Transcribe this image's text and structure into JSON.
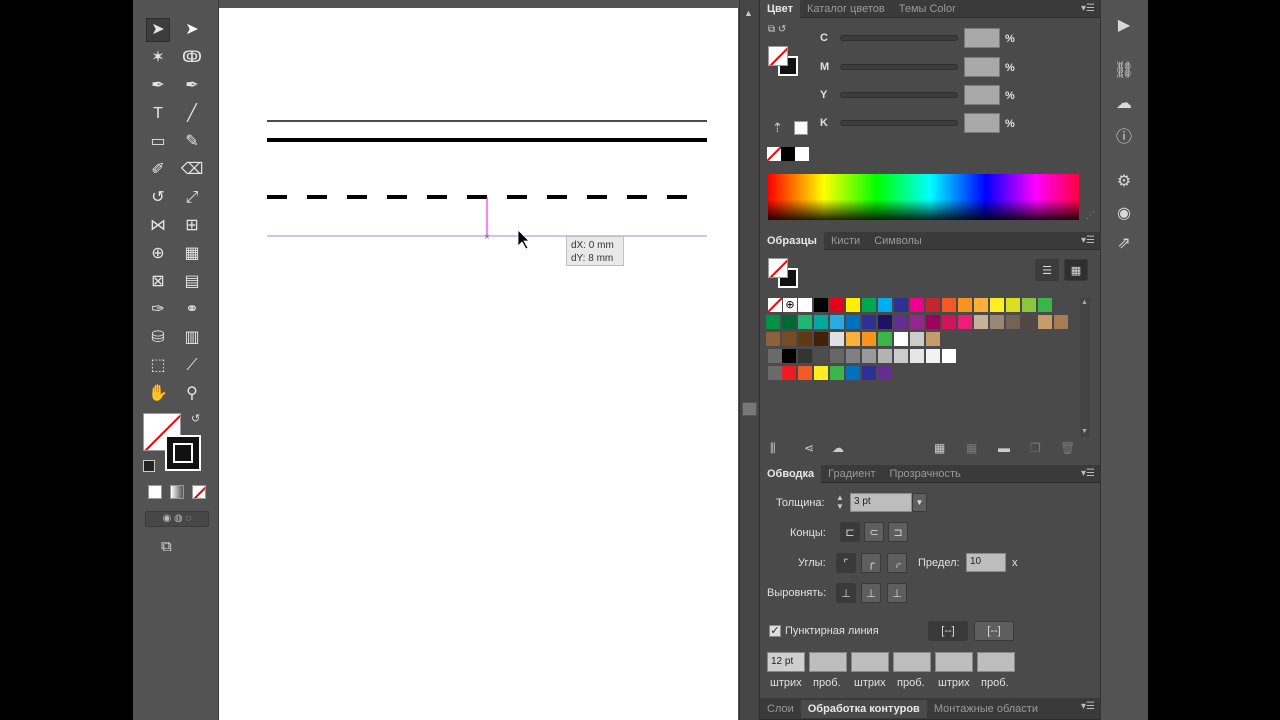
{
  "colors": {
    "panel_bg": "#4a4a4a",
    "toolbar_bg": "#535353",
    "artboard": "#ffffff",
    "guide_blue": "#8b8bff",
    "magenta": "#ff00ff"
  },
  "tools": [
    {
      "name": "selection-tool",
      "icon": "arrow-icon",
      "glyph": "➤"
    },
    {
      "name": "direct-selection-tool",
      "icon": "white-arrow-icon",
      "glyph": "➤"
    },
    {
      "name": "magic-wand-tool",
      "icon": "magic-wand-icon",
      "glyph": "✶"
    },
    {
      "name": "lasso-tool",
      "icon": "lasso-icon",
      "glyph": "ↂ"
    },
    {
      "name": "pen-tool",
      "icon": "pen-icon",
      "glyph": "✒"
    },
    {
      "name": "curvature-tool",
      "icon": "curvature-pen-icon",
      "glyph": "✒"
    },
    {
      "name": "type-tool",
      "icon": "type-icon",
      "glyph": "T"
    },
    {
      "name": "line-tool",
      "icon": "line-icon",
      "glyph": "╱"
    },
    {
      "name": "rectangle-tool",
      "icon": "rectangle-icon",
      "glyph": "▭"
    },
    {
      "name": "paintbrush-tool",
      "icon": "brush-icon",
      "glyph": "✎"
    },
    {
      "name": "shaper-tool",
      "icon": "shaper-icon",
      "glyph": "✐"
    },
    {
      "name": "eraser-tool",
      "icon": "eraser-icon",
      "glyph": "⌫"
    },
    {
      "name": "rotate-tool",
      "icon": "rotate-icon",
      "glyph": "↺"
    },
    {
      "name": "scale-tool",
      "icon": "scale-icon",
      "glyph": "⤢"
    },
    {
      "name": "width-tool",
      "icon": "width-icon",
      "glyph": "⋈"
    },
    {
      "name": "free-transform-tool",
      "icon": "free-transform-icon",
      "glyph": "⊞"
    },
    {
      "name": "shape-builder-tool",
      "icon": "shape-builder-icon",
      "glyph": "⊕"
    },
    {
      "name": "perspective-grid-tool",
      "icon": "perspective-grid-icon",
      "glyph": "▦"
    },
    {
      "name": "mesh-tool",
      "icon": "mesh-icon",
      "glyph": "⊠"
    },
    {
      "name": "gradient-tool",
      "icon": "gradient-icon",
      "glyph": "▤"
    },
    {
      "name": "eyedropper-tool",
      "icon": "eyedropper-icon",
      "glyph": "✑"
    },
    {
      "name": "blend-tool",
      "icon": "blend-icon",
      "glyph": "⚭"
    },
    {
      "name": "symbol-sprayer-tool",
      "icon": "symbol-sprayer-icon",
      "glyph": "⛁"
    },
    {
      "name": "column-graph-tool",
      "icon": "column-graph-icon",
      "glyph": "▥"
    },
    {
      "name": "artboard-tool",
      "icon": "artboard-icon",
      "glyph": "⬚"
    },
    {
      "name": "slice-tool",
      "icon": "slice-icon",
      "glyph": "⟋"
    },
    {
      "name": "hand-tool",
      "icon": "hand-icon",
      "glyph": "✋"
    },
    {
      "name": "zoom-tool",
      "icon": "zoom-icon",
      "glyph": "⚲"
    }
  ],
  "tooltip": {
    "dx": "dX: 0 mm",
    "dy": "dY: 8 mm"
  },
  "color_panel": {
    "tabs": [
      "Цвет",
      "Каталог цветов",
      "Темы Color"
    ],
    "channels": [
      "C",
      "M",
      "Y",
      "K"
    ],
    "pct": "%"
  },
  "swatches_panel": {
    "tabs": [
      "Образцы",
      "Кисти",
      "Символы"
    ],
    "rows": [
      [
        "#ffffff",
        "#000000",
        "#e6001f",
        "#ffef00",
        "#00a651",
        "#00aeef",
        "#2e3192",
        "#ec008c",
        "#c1272d",
        "#f15a24",
        "#f7931e",
        "#fbb03b",
        "#fcee21",
        "#d9e021",
        "#8cc63f",
        "#39b54a"
      ],
      [
        "#009245",
        "#006837",
        "#22b573",
        "#00a99d",
        "#29abe2",
        "#0071bc",
        "#2e3192",
        "#1b1464",
        "#662d91",
        "#93278f",
        "#9e005d",
        "#d4145a",
        "#ed1e79",
        "#c7b299",
        "#998675",
        "#736357",
        "#534741",
        "#c69c6d",
        "#a67c52"
      ],
      [
        "#8c6239",
        "#754c24",
        "#603813",
        "#42210b",
        "#e0e0e0",
        "#fbb03b",
        "#f7931e",
        "#39b54a",
        "#ffffff",
        "#cccccc",
        "#c69c6d"
      ],
      [
        "#000000",
        "#333333",
        "#4d4d4d",
        "#666666",
        "#808080",
        "#999999",
        "#b3b3b3",
        "#cccccc",
        "#e6e6e6",
        "#f2f2f2",
        "#ffffff"
      ],
      [
        "#ed1c24",
        "#f15a24",
        "#fcee21",
        "#39b54a",
        "#0071bc",
        "#2e3192",
        "#662d91"
      ]
    ]
  },
  "stroke_panel": {
    "tabs": [
      "Обводка",
      "Градиент",
      "Прозрачность"
    ],
    "weight_label": "Толщина:",
    "weight_value": "3 pt",
    "caps_label": "Концы:",
    "corners_label": "Углы:",
    "limit_label": "Предел:",
    "limit_value": "10",
    "limit_unit": "x",
    "align_label": "Выровнять:",
    "dashed_label": "Пунктирная линия",
    "dash1": "12 pt",
    "dash_labels": [
      "штрих",
      "проб.",
      "штрих",
      "проб.",
      "штрих",
      "проб."
    ]
  },
  "bottom_tabs": [
    "Слои",
    "Обработка контуров",
    "Монтажные области"
  ]
}
